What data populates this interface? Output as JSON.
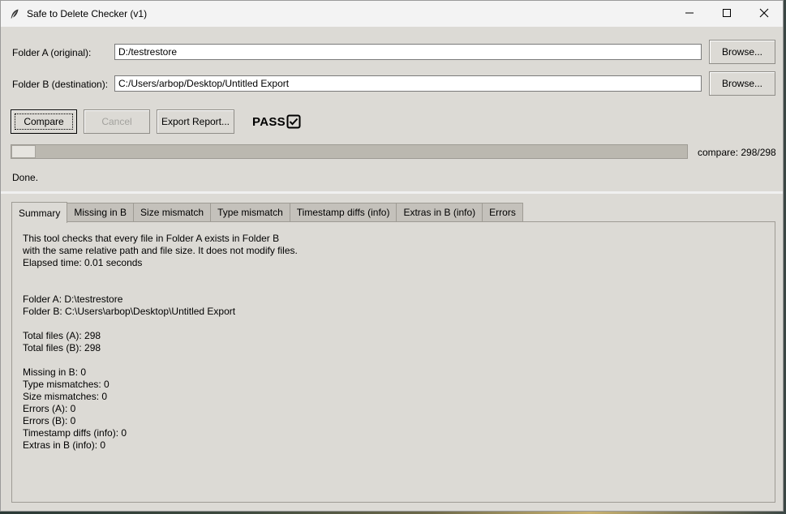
{
  "window": {
    "title": "Safe to Delete Checker (v1)",
    "app_icon": "feather-icon",
    "controls": [
      "minimize-icon",
      "maximize-icon",
      "close-icon"
    ]
  },
  "folder_a": {
    "label": "Folder A (original):",
    "value": "D:/testrestore",
    "browse_label": "Browse..."
  },
  "folder_b": {
    "label": "Folder B (destination):",
    "value": "C:/Users/arbop/Desktop/Untitled Export",
    "browse_label": "Browse..."
  },
  "actions": {
    "compare_label": "Compare",
    "cancel_label": "Cancel",
    "export_label": "Export Report..."
  },
  "result": {
    "label": "PASS",
    "icon": "checkbox-checked-icon"
  },
  "progress": {
    "fraction": 0.036,
    "text": "compare: 298/298"
  },
  "status": "Done.",
  "tabs": [
    {
      "label": "Summary",
      "active": true
    },
    {
      "label": "Missing in B"
    },
    {
      "label": "Size mismatch"
    },
    {
      "label": "Type mismatch"
    },
    {
      "label": "Timestamp diffs (info)"
    },
    {
      "label": "Extras in B (info)"
    },
    {
      "label": "Errors"
    }
  ],
  "summary": {
    "text": "This tool checks that every file in Folder A exists in Folder B\nwith the same relative path and file size. It does not modify files.\nElapsed time: 0.01 seconds\n\n\nFolder A: D:\\testrestore\nFolder B: C:\\Users\\arbop\\Desktop\\Untitled Export\n\nTotal files (A): 298\nTotal files (B): 298\n\nMissing in B: 0\nType mismatches: 0\nSize mismatches: 0\nErrors (A): 0\nErrors (B): 0\nTimestamp diffs (info): 0\nExtras in B (info): 0"
  },
  "colors": {
    "window_bg": "#dcdad5",
    "progress_trough": "#bbb8b0",
    "tab_inactive": "#c4c1bb"
  }
}
